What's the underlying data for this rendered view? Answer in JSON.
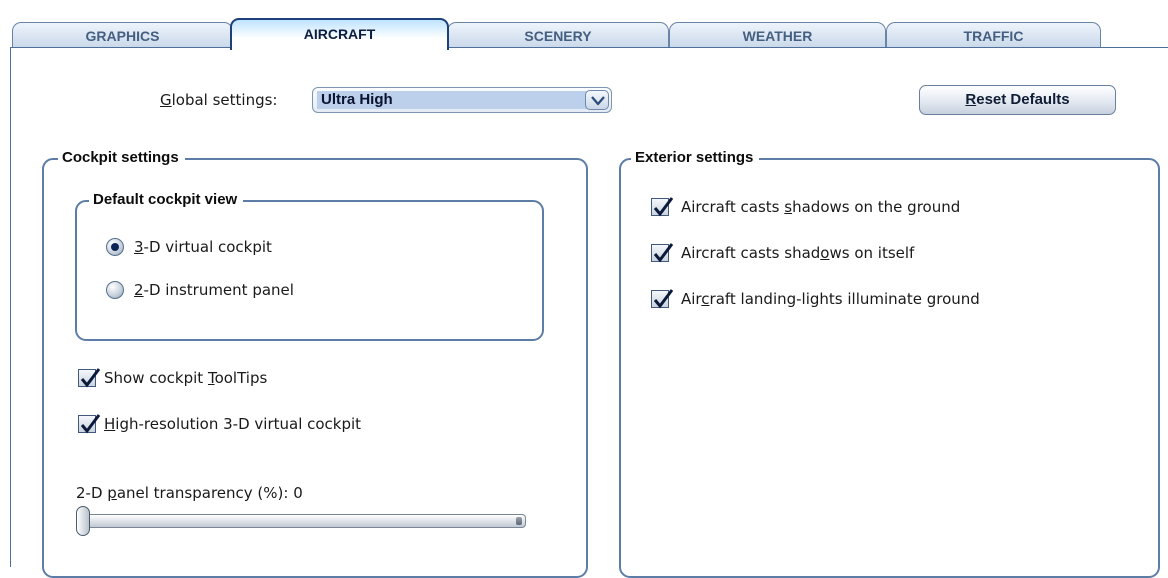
{
  "tabs": [
    {
      "label": "GRAPHICS",
      "active": false
    },
    {
      "label": "AIRCRAFT",
      "active": true
    },
    {
      "label": "SCENERY",
      "active": false
    },
    {
      "label": "WEATHER",
      "active": false
    },
    {
      "label": "TRAFFIC",
      "active": false
    }
  ],
  "global": {
    "label_pre": "",
    "label_ul": "G",
    "label_post": "lobal settings:",
    "selected": "Ultra High",
    "reset_ul": "R",
    "reset_post": "eset Defaults"
  },
  "cockpit": {
    "title": "Cockpit settings",
    "view_group": {
      "title": "Default cockpit view",
      "options": [
        {
          "pre": "",
          "ul": "3",
          "post": "-D virtual cockpit",
          "selected": true,
          "icon": "radio-selected-icon"
        },
        {
          "pre": "",
          "ul": "2",
          "post": "-D instrument panel",
          "selected": false,
          "icon": "radio-unselected-icon"
        }
      ]
    },
    "checks": [
      {
        "pre": "Show cockpit ",
        "ul": "T",
        "post": "oolTips",
        "checked": true
      },
      {
        "pre": "",
        "ul": "H",
        "post": "igh-resolution 3-D virtual cockpit",
        "checked": true
      }
    ],
    "slider": {
      "label_pre": "2-D ",
      "label_ul": "p",
      "label_post": "anel transparency (%): 0",
      "value": 0,
      "min": 0,
      "max": 100
    }
  },
  "exterior": {
    "title": "Exterior settings",
    "checks": [
      {
        "pre": "Aircraft casts ",
        "ul": "s",
        "post": "hadows on the ground",
        "checked": true
      },
      {
        "pre": "Aircraft casts shad",
        "ul": "o",
        "post": "ws on itself",
        "checked": true
      },
      {
        "pre": "Air",
        "ul": "c",
        "post": "raft landing-lights illuminate ground",
        "checked": true
      }
    ]
  },
  "colors": {
    "frame": "#4e6f99",
    "active_tab_border": "#1d3f7a",
    "selection": "#bcd0ec",
    "check_mark": "#0b1a3a"
  }
}
